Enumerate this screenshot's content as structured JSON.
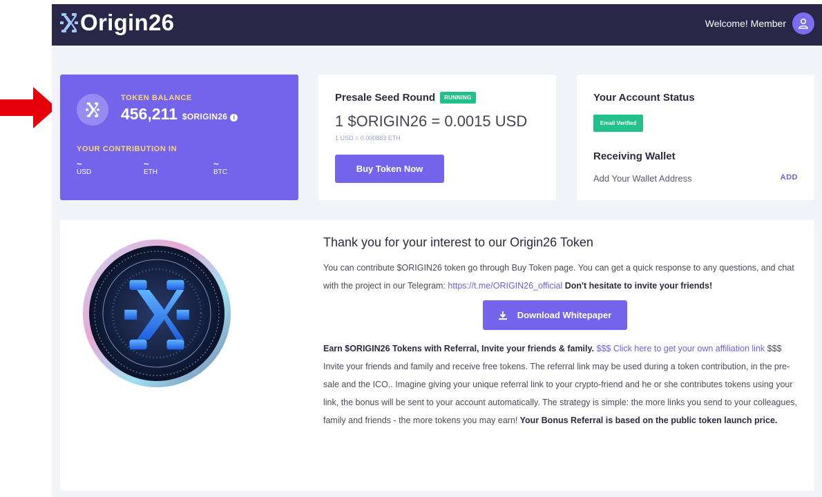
{
  "header": {
    "brand": "Origin26",
    "welcome": "Welcome! Member"
  },
  "balance": {
    "label": "TOKEN BALANCE",
    "value": "456,211",
    "unit": "$ORIGIN26",
    "contribution_label": "YOUR CONTRIBUTION IN",
    "contributions": [
      {
        "value": "~",
        "currency": "USD"
      },
      {
        "value": "~",
        "currency": "ETH"
      },
      {
        "value": "~",
        "currency": "BTC"
      }
    ]
  },
  "presale": {
    "title": "Presale Seed Round",
    "badge": "RUNNING",
    "price": "1 $ORIGIN26 = 0.0015 USD",
    "price_sub": "1 USD = 0.000883 ETH",
    "button": "Buy Token Now"
  },
  "account": {
    "title": "Your Account Status",
    "badge": "Email Verified",
    "wallet_title": "Receiving Wallet",
    "wallet_text": "Add Your Wallet Address",
    "wallet_action": "ADD"
  },
  "info": {
    "title": "Thank you for your interest to our Origin26 Token",
    "p1_text": "You can contribute $ORIGIN26 token go through Buy Token page. You can get a quick response to any questions, and chat with the project in our Telegram: ",
    "p1_link": "https://t.me/ORIGIN26_official",
    "p1_bold": " Don't hesitate to invite your friends!",
    "download_button": "Download Whitepaper",
    "p2_bold": "Earn $ORIGIN26 Tokens with Referral, Invite your friends & family.",
    "p2_link": " $$$ Click here to get your own affiliation link",
    "p2_tail": " $$$",
    "p3_text": "Invite your friends and family and receive free tokens. The referral link may be used during a token contribution, in the pre-sale and the ICO.. Imagine giving your unique referral link to your crypto-friend and he or she contributes tokens using your link, the bonus will be sent to your account automatically. The strategy is simple: the more links you send to your colleagues, family and friends - the more tokens you may earn!",
    "p3_bold": " Your Bonus Referral is based on the public token launch price."
  },
  "colors": {
    "header_bg": "#2a2647",
    "accent": "#7464ec",
    "success": "#22c08a",
    "highlight": "#f7d774",
    "annotation_arrow": "#e5000a"
  },
  "icons": [
    "red-arrow-annotation",
    "origin26-logo-icon",
    "user-avatar-icon",
    "token-logo-icon",
    "info-icon",
    "download-icon",
    "coin-image"
  ]
}
